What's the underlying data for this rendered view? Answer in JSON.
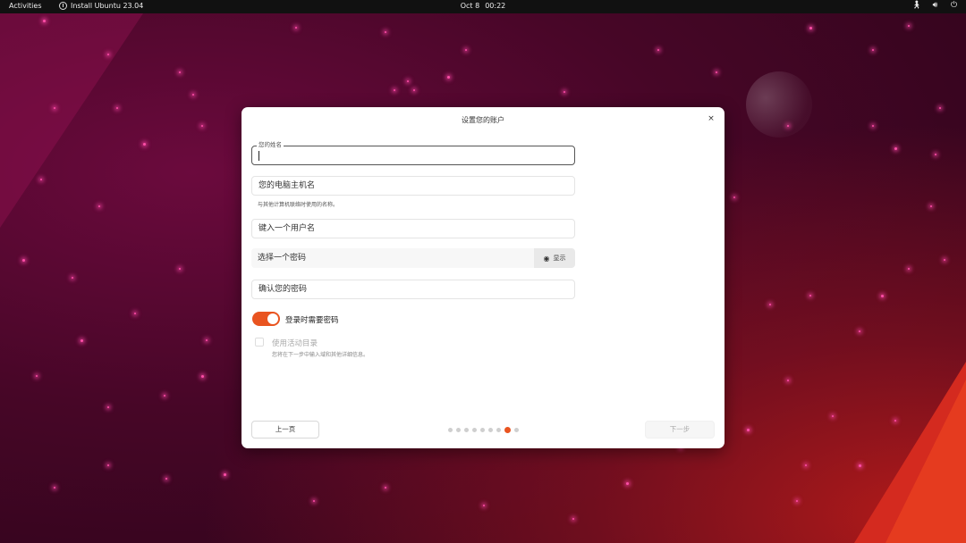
{
  "topbar": {
    "activities": "Activities",
    "app_name": "Install Ubuntu 23.04",
    "date": "Oct 8",
    "time": "00:22"
  },
  "dialog": {
    "title": "设置您的账户",
    "close_icon": "×",
    "name_field": {
      "legend": "您的姓名",
      "value": ""
    },
    "hostname_field": {
      "placeholder": "您的电脑主机名"
    },
    "hostname_hint": "与其他计算机联络时使用的名称。",
    "username_field": {
      "placeholder": "键入一个用户名"
    },
    "password_field": {
      "placeholder": "选择一个密码"
    },
    "show_button": {
      "icon": "eye-icon",
      "label": "显示"
    },
    "confirm_field": {
      "placeholder": "确认您的密码"
    },
    "require_password": {
      "label": "登录时需要密码",
      "checked": true
    },
    "active_directory": {
      "label": "使用活动目录",
      "hint": "您将在下一步中输入域和其他详细信息。",
      "checked": false
    },
    "back_button": "上一页",
    "next_button": "下一步",
    "progress": {
      "total_steps": 9,
      "current_step": 8
    }
  },
  "colors": {
    "accent": "#e95420",
    "topbar": "#111111"
  }
}
